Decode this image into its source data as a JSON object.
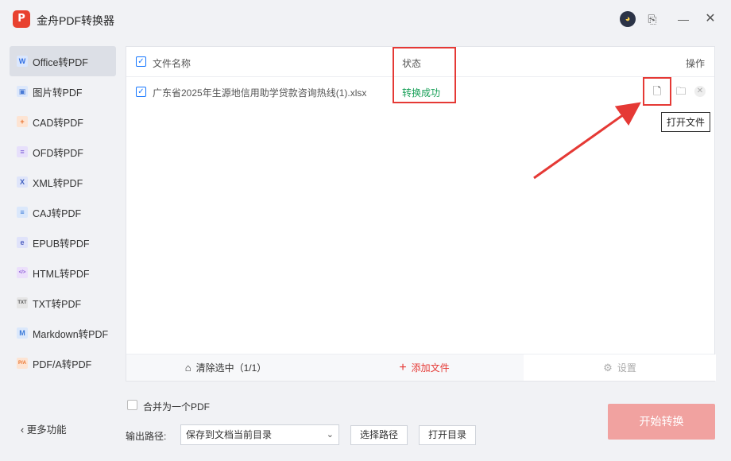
{
  "app": {
    "logo_text": "P",
    "title": "金舟PDF转换器"
  },
  "titlebar": {
    "avatar_glyph": "◕",
    "feedback_glyph": "⎘",
    "minimize_glyph": "—",
    "close_glyph": "✕"
  },
  "sidebar": {
    "items": [
      {
        "label": "Office转PDF",
        "icon": "W",
        "icon_color": "#2f6fe4",
        "icon_bg": "#dbe7fd"
      },
      {
        "label": "图片转PDF",
        "icon": "▣",
        "icon_color": "#4a7bd6",
        "icon_bg": "#dde8fb"
      },
      {
        "label": "CAD转PDF",
        "icon": "+",
        "icon_color": "#e9722c",
        "icon_bg": "#fde4d3"
      },
      {
        "label": "OFD转PDF",
        "icon": "≡",
        "icon_color": "#7a5bd6",
        "icon_bg": "#e7e0fb"
      },
      {
        "label": "XML转PDF",
        "icon": "X",
        "icon_color": "#3f5fbf",
        "icon_bg": "#dfe5fa"
      },
      {
        "label": "CAJ转PDF",
        "icon": "≡",
        "icon_color": "#3a79d8",
        "icon_bg": "#dbe8fb"
      },
      {
        "label": "EPUB转PDF",
        "icon": "e",
        "icon_color": "#4f5fbf",
        "icon_bg": "#e0e3fa"
      },
      {
        "label": "HTML转PDF",
        "icon": "</>",
        "icon_color": "#8a59d6",
        "icon_bg": "#ece0fb"
      },
      {
        "label": "TXT转PDF",
        "icon": "TXT",
        "icon_color": "#555555",
        "icon_bg": "#e6e6e6"
      },
      {
        "label": "Markdown转PDF",
        "icon": "M",
        "icon_color": "#3a79d8",
        "icon_bg": "#dbe8fb"
      },
      {
        "label": "PDF/A转PDF",
        "icon": "P/A",
        "icon_color": "#e9722c",
        "icon_bg": "#fde4d3"
      }
    ],
    "more_label": "更多功能",
    "more_glyph": "‹"
  },
  "table": {
    "col_name": "文件名称",
    "col_status": "状态",
    "col_ops": "操作",
    "rows": [
      {
        "file_name": "广东省2025年生源地信用助学贷款咨询热线(1).xlsx",
        "status": "转换成功"
      }
    ],
    "op_open_glyph": "🗋",
    "op_folder_glyph": "🗀",
    "op_delete_glyph": "✕",
    "tooltip": "打开文件"
  },
  "footer": {
    "clear_label": "清除选中（1/1）",
    "clear_glyph": "⌂",
    "add_label": "添加文件",
    "add_glyph": "+",
    "settings_label": "设置",
    "settings_glyph": "⚙"
  },
  "options": {
    "merge_label": "合并为一个PDF",
    "path_label": "输出路径:",
    "path_value": "保存到文档当前目录",
    "choose_path": "选择路径",
    "open_dir": "打开目录",
    "start": "开始转换"
  },
  "colors": {
    "accent": "#e53935",
    "success": "#18a058",
    "check": "#1677ff"
  }
}
